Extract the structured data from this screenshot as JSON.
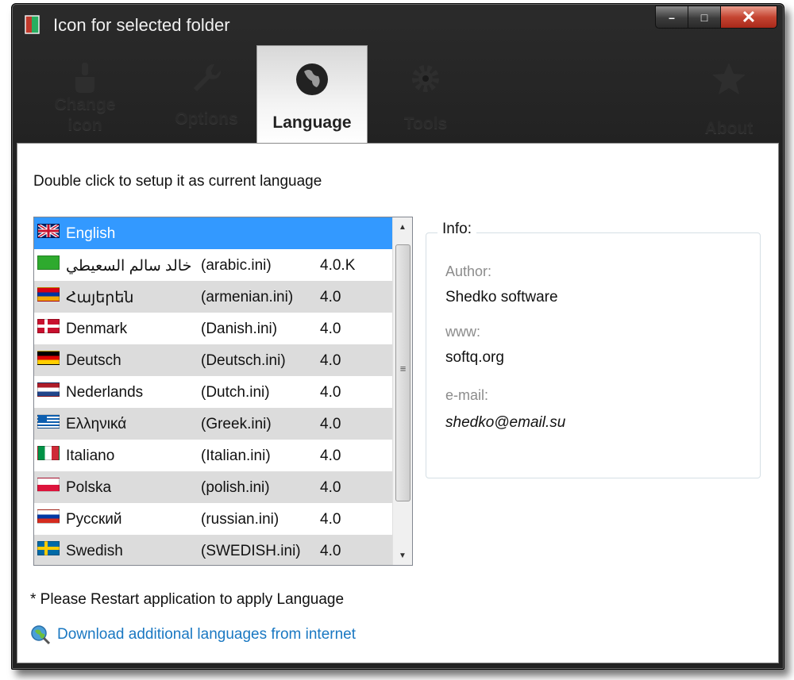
{
  "window": {
    "title": "Icon for selected folder",
    "buttons": {
      "minimize": "–",
      "maximize": "□",
      "close": "✕"
    }
  },
  "tabs": [
    {
      "id": "change-icon",
      "label": "Change icon",
      "icon": "paint-brush-icon"
    },
    {
      "id": "options",
      "label": "Options",
      "icon": "wrench-icon"
    },
    {
      "id": "language",
      "label": "Language",
      "icon": "globe-icon",
      "active": true
    },
    {
      "id": "tools",
      "label": "Tools",
      "icon": "gear-icon"
    },
    {
      "id": "about",
      "label": "About",
      "icon": "star-icon"
    }
  ],
  "main": {
    "hint": "Double click to setup it as current language",
    "languages": [
      {
        "name": "English",
        "file": "",
        "version": "",
        "flag": "uk",
        "selected": true
      },
      {
        "name": "خالد سالم السعيطي",
        "file": "(arabic.ini)",
        "version": "4.0.K",
        "flag": "green"
      },
      {
        "name": "Հայերեն",
        "file": "(armenian.ini)",
        "version": "4.0",
        "flag": "armenia"
      },
      {
        "name": "Denmark",
        "file": "(Danish.ini)",
        "version": "4.0",
        "flag": "denmark"
      },
      {
        "name": "Deutsch",
        "file": "(Deutsch.ini)",
        "version": "4.0",
        "flag": "germany"
      },
      {
        "name": "Nederlands",
        "file": "(Dutch.ini)",
        "version": "4.0",
        "flag": "netherlands"
      },
      {
        "name": "Ελληνικά",
        "file": "(Greek.ini)",
        "version": "4.0",
        "flag": "greece"
      },
      {
        "name": "Italiano",
        "file": "(Italian.ini)",
        "version": "4.0",
        "flag": "italy"
      },
      {
        "name": "Polska",
        "file": "(polish.ini)",
        "version": "4.0",
        "flag": "poland"
      },
      {
        "name": "Русский",
        "file": "(russian.ini)",
        "version": "4.0",
        "flag": "russia"
      },
      {
        "name": "Swedish",
        "file": "(SWEDISH.ini)",
        "version": "4.0",
        "flag": "sweden"
      }
    ],
    "info": {
      "legend": "Info:",
      "author_label": "Author:",
      "author": "Shedko software",
      "www_label": "www:",
      "www": "softq.org",
      "email_label": "e-mail:",
      "email": "shedko@email.su"
    },
    "restart_note": "* Please Restart application to apply Language",
    "download_link": "Download additional languages from internet"
  },
  "colors": {
    "selection": "#3399ff",
    "link": "#1a78c2",
    "alt_row": "#dcdcdc",
    "close_button": "#c54532"
  }
}
